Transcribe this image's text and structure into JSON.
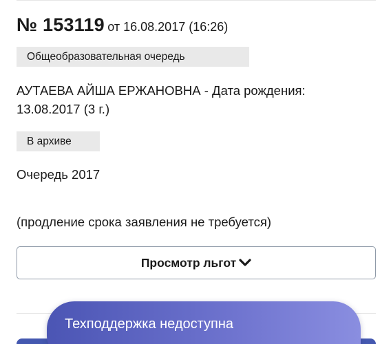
{
  "application": {
    "number": "№ 153119",
    "date_text": "от 16.08.2017 (16:26)"
  },
  "queue_type": "Общеобразовательная очередь",
  "child": {
    "info": "АУТАЕВА АЙША ЕРЖАНОВНА - Дата рождения: 13.08.2017 (3 г.)"
  },
  "status": "В архиве",
  "queue_year": "Очередь 2017",
  "renewal_note": "(продление срока заявления не требуется)",
  "benefits_button": {
    "label": "Просмотр льгот",
    "icon": "chevron-down-icon"
  },
  "support": {
    "text": "Техподдержка недоступна"
  },
  "colors": {
    "tag_bg": "#e9e9e9",
    "button_border": "#8f9aa8",
    "toast_start": "#4b55b4",
    "toast_end": "#8a8ee0"
  }
}
